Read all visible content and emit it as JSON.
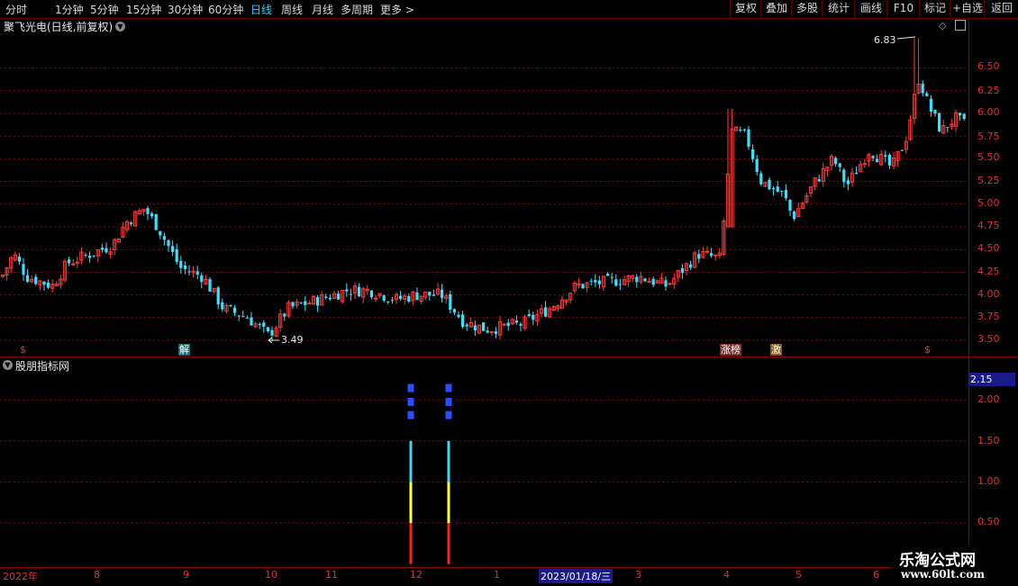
{
  "toolbar": {
    "periods": [
      "分时",
      "1分钟",
      "5分钟",
      "15分钟",
      "30分钟",
      "60分钟",
      "日线",
      "周线",
      "月线",
      "多周期",
      "更多 >"
    ],
    "active_period": "日线",
    "right_buttons": [
      "复权",
      "叠加",
      "多股",
      "统计",
      "画线",
      "F10",
      "标记",
      "+自选",
      "返回"
    ]
  },
  "chart": {
    "title": "聚飞光电(日线,前复权)",
    "high_label": "6.83",
    "low_label": "3.49",
    "price_ticks": [
      "6.50",
      "6.25",
      "6.00",
      "5.75",
      "5.50",
      "5.25",
      "5.00",
      "4.75",
      "4.50",
      "4.25",
      "4.00",
      "3.75",
      "3.50"
    ],
    "tags": [
      "$",
      "解",
      "涨榜",
      "激",
      "$"
    ],
    "colors": {
      "up": "#ff3a3a",
      "down": "#3ce0ff",
      "grid": "#8b0000",
      "axis": "#e03030"
    }
  },
  "indicator": {
    "title": "股朋指标网",
    "current_value": "2.15",
    "ticks": [
      "2.00",
      "1.50",
      "1.00",
      "0.50"
    ],
    "colors": {
      "dash": "#2a4cff",
      "cyan": "#40d8f0",
      "yellow": "#ffff40",
      "red": "#ff2020"
    }
  },
  "dates": {
    "labels": [
      "2022年",
      "8",
      "9",
      "10",
      "11",
      "12",
      "1",
      "2023/01/18/三",
      "3",
      "4",
      "5",
      "6"
    ],
    "selected": "2023/01/18/三"
  },
  "watermark": {
    "title": "乐淘公式网",
    "url": "www.60lt.com"
  }
}
